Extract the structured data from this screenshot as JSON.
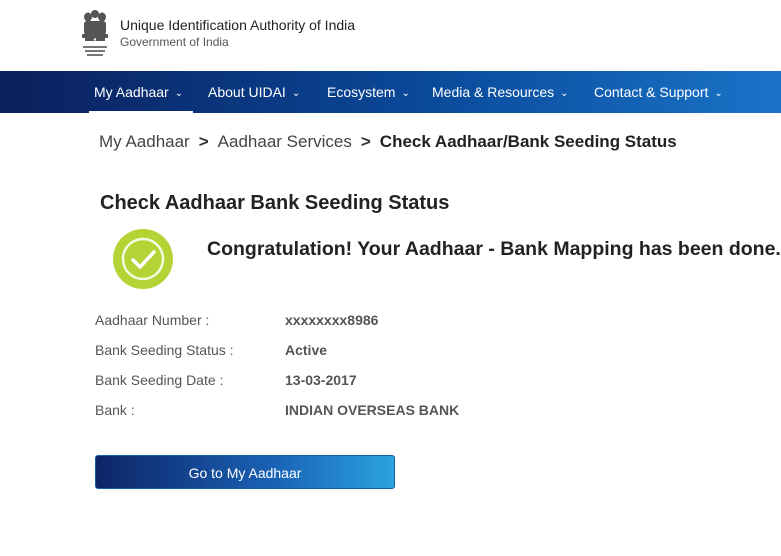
{
  "header": {
    "org_name": "Unique Identification Authority of India",
    "org_sub": "Government of India",
    "logo_icon": "national-emblem-icon"
  },
  "nav": {
    "items": [
      {
        "label": "My Aadhaar"
      },
      {
        "label": "About UIDAI"
      },
      {
        "label": "Ecosystem"
      },
      {
        "label": "Media & Resources"
      },
      {
        "label": "Contact & Support"
      }
    ],
    "active": "My Aadhaar"
  },
  "breadcrumb": {
    "items": [
      "My Aadhaar",
      "Aadhaar Services",
      "Check Aadhaar/Bank Seeding Status"
    ],
    "separator": ">"
  },
  "page": {
    "title": "Check Aadhaar Bank Seeding Status",
    "success_message": "Congratulation! Your Aadhaar - Bank Mapping has been done."
  },
  "details": [
    {
      "label": "Aadhaar Number :",
      "value": "xxxxxxxx8986"
    },
    {
      "label": "Bank Seeding Status :",
      "value": "Active"
    },
    {
      "label": "Bank Seeding Date :",
      "value": "13-03-2017"
    },
    {
      "label": "Bank :",
      "value": "INDIAN OVERSEAS BANK"
    }
  ],
  "cta": {
    "label": "Go to My Aadhaar"
  },
  "colors": {
    "nav_start": "#0b1f5c",
    "nav_end": "#1a73c8",
    "success_green": "#b5d334"
  }
}
